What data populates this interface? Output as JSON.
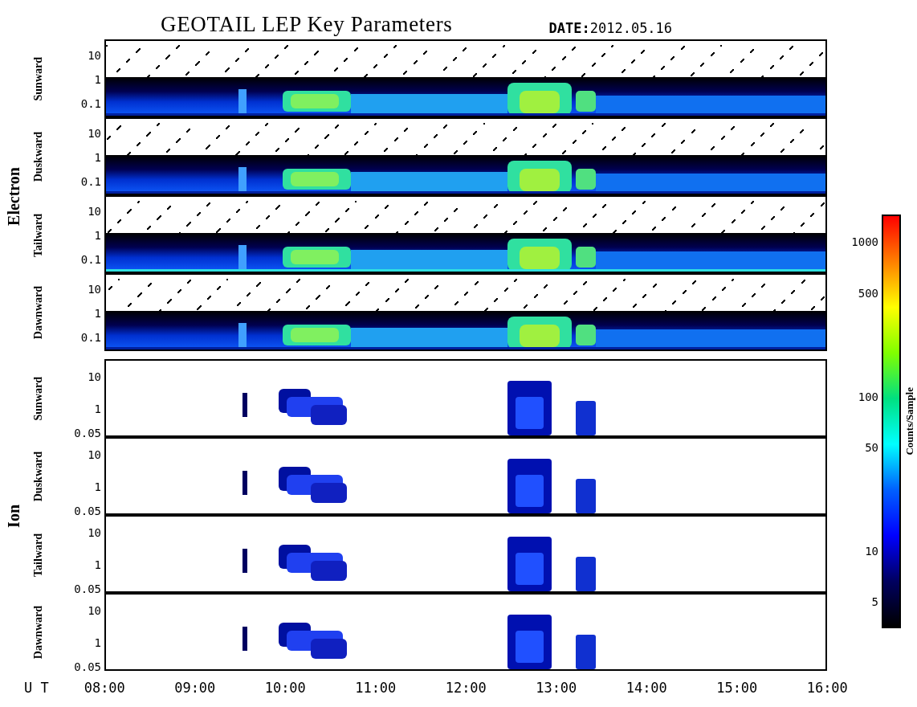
{
  "title": "GEOTAIL LEP Key Parameters",
  "date": "**DATE:**2012.05.16",
  "groups": [
    {
      "name": "Electron",
      "kind": "electron",
      "panels": [
        {
          "label": "Sunward",
          "yticks": [
            "10",
            "1",
            "0.1"
          ]
        },
        {
          "label": "Duskward",
          "yticks": [
            "10",
            "1",
            "0.1"
          ]
        },
        {
          "label": "Tailward",
          "yticks": [
            "10",
            "1",
            "0.1"
          ]
        },
        {
          "label": "Dawnward",
          "yticks": [
            "10",
            "1",
            "0.1"
          ]
        }
      ]
    },
    {
      "name": "Ion",
      "kind": "ion",
      "panels": [
        {
          "label": "Sunward",
          "yticks": [
            "10",
            "1",
            "0.05"
          ]
        },
        {
          "label": "Duskward",
          "yticks": [
            "10",
            "1",
            "0.05"
          ]
        },
        {
          "label": "Tailward",
          "yticks": [
            "10",
            "1",
            "0.05"
          ]
        },
        {
          "label": "Dawnward",
          "yticks": [
            "10",
            "1",
            "0.05"
          ]
        }
      ]
    }
  ],
  "x_axis": {
    "label": "U T",
    "ticks": [
      "08:00",
      "09:00",
      "10:00",
      "11:00",
      "12:00",
      "13:00",
      "14:00",
      "15:00",
      "16:00"
    ]
  },
  "colorbar": {
    "label": "Counts/Sample",
    "ticks": [
      "1000",
      "500",
      "100",
      "50",
      "10",
      "5"
    ]
  }
}
